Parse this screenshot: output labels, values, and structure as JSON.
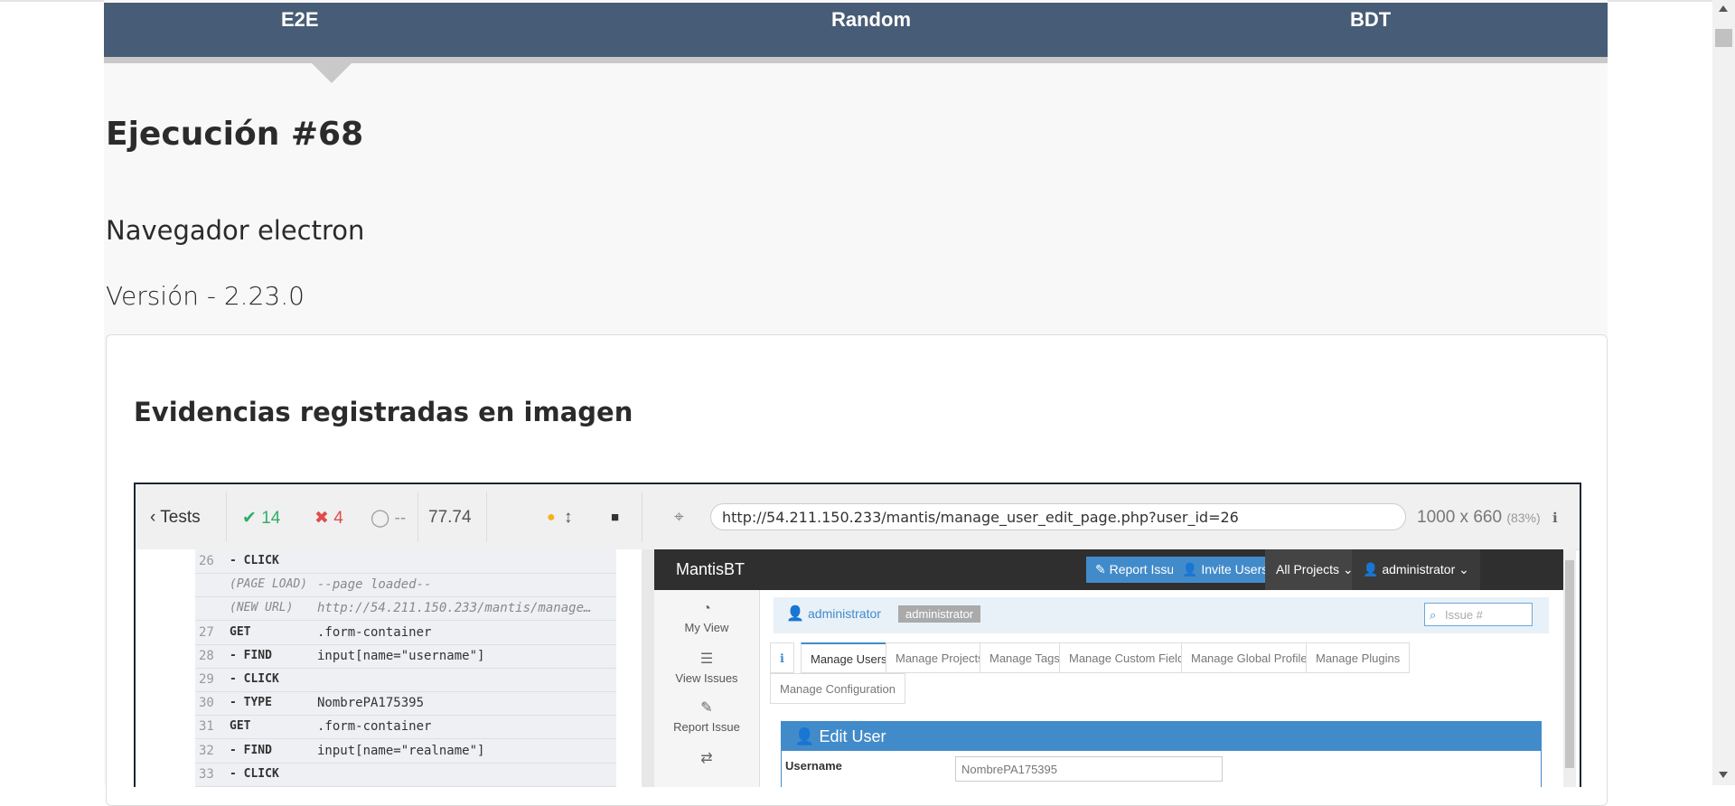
{
  "topnav": {
    "tabs": [
      "E2E",
      "Random",
      "BDT"
    ]
  },
  "execution": {
    "title": "Ejecución #68",
    "browser": "Navegador electron",
    "version": "Versión - 2.23.0"
  },
  "evidence": {
    "heading": "Evidencias registradas en imagen"
  },
  "runner": {
    "tests_label": "Tests",
    "passed": "14",
    "failed": "4",
    "pending": "--",
    "duration": "77.74",
    "url": "http://54.211.150.233/mantis/manage_user_edit_page.php?user_id=26",
    "viewport": "1000 x 660",
    "zoom": "(83%)",
    "commands": [
      {
        "num": "26",
        "kind": "- CLICK",
        "arg": ""
      },
      {
        "num": "",
        "kind": "(PAGE LOAD)",
        "arg": "--page loaded--"
      },
      {
        "num": "",
        "kind": "(NEW URL)",
        "arg": "http://54.211.150.233/mantis/manage…"
      },
      {
        "num": "27",
        "kind": "GET",
        "arg": ".form-container"
      },
      {
        "num": "28",
        "kind": "- FIND",
        "arg": "input[name=\"username\"]"
      },
      {
        "num": "29",
        "kind": "- CLICK",
        "arg": ""
      },
      {
        "num": "30",
        "kind": "- TYPE",
        "arg": "NombrePA175395"
      },
      {
        "num": "31",
        "kind": "GET",
        "arg": ".form-container"
      },
      {
        "num": "32",
        "kind": "- FIND",
        "arg": "input[name=\"realname\"]"
      },
      {
        "num": "33",
        "kind": "- CLICK",
        "arg": ""
      }
    ]
  },
  "mantis": {
    "logo": "MantisBT",
    "report_issue": "Report Issue",
    "invite_users": "Invite Users",
    "all_projects": "All Projects",
    "user": "administrator",
    "sidebar": [
      "My View",
      "View Issues",
      "Report Issue"
    ],
    "breadcrumb_user": "administrator",
    "breadcrumb_tag": "administrator",
    "search_placeholder": "Issue #",
    "tabs": [
      "Manage Users",
      "Manage Projects",
      "Manage Tags",
      "Manage Custom Fields",
      "Manage Global Profiles",
      "Manage Plugins",
      "Manage Configuration"
    ],
    "edit_title": "Edit User",
    "username_label": "Username",
    "username_value": "NombrePA175395"
  }
}
